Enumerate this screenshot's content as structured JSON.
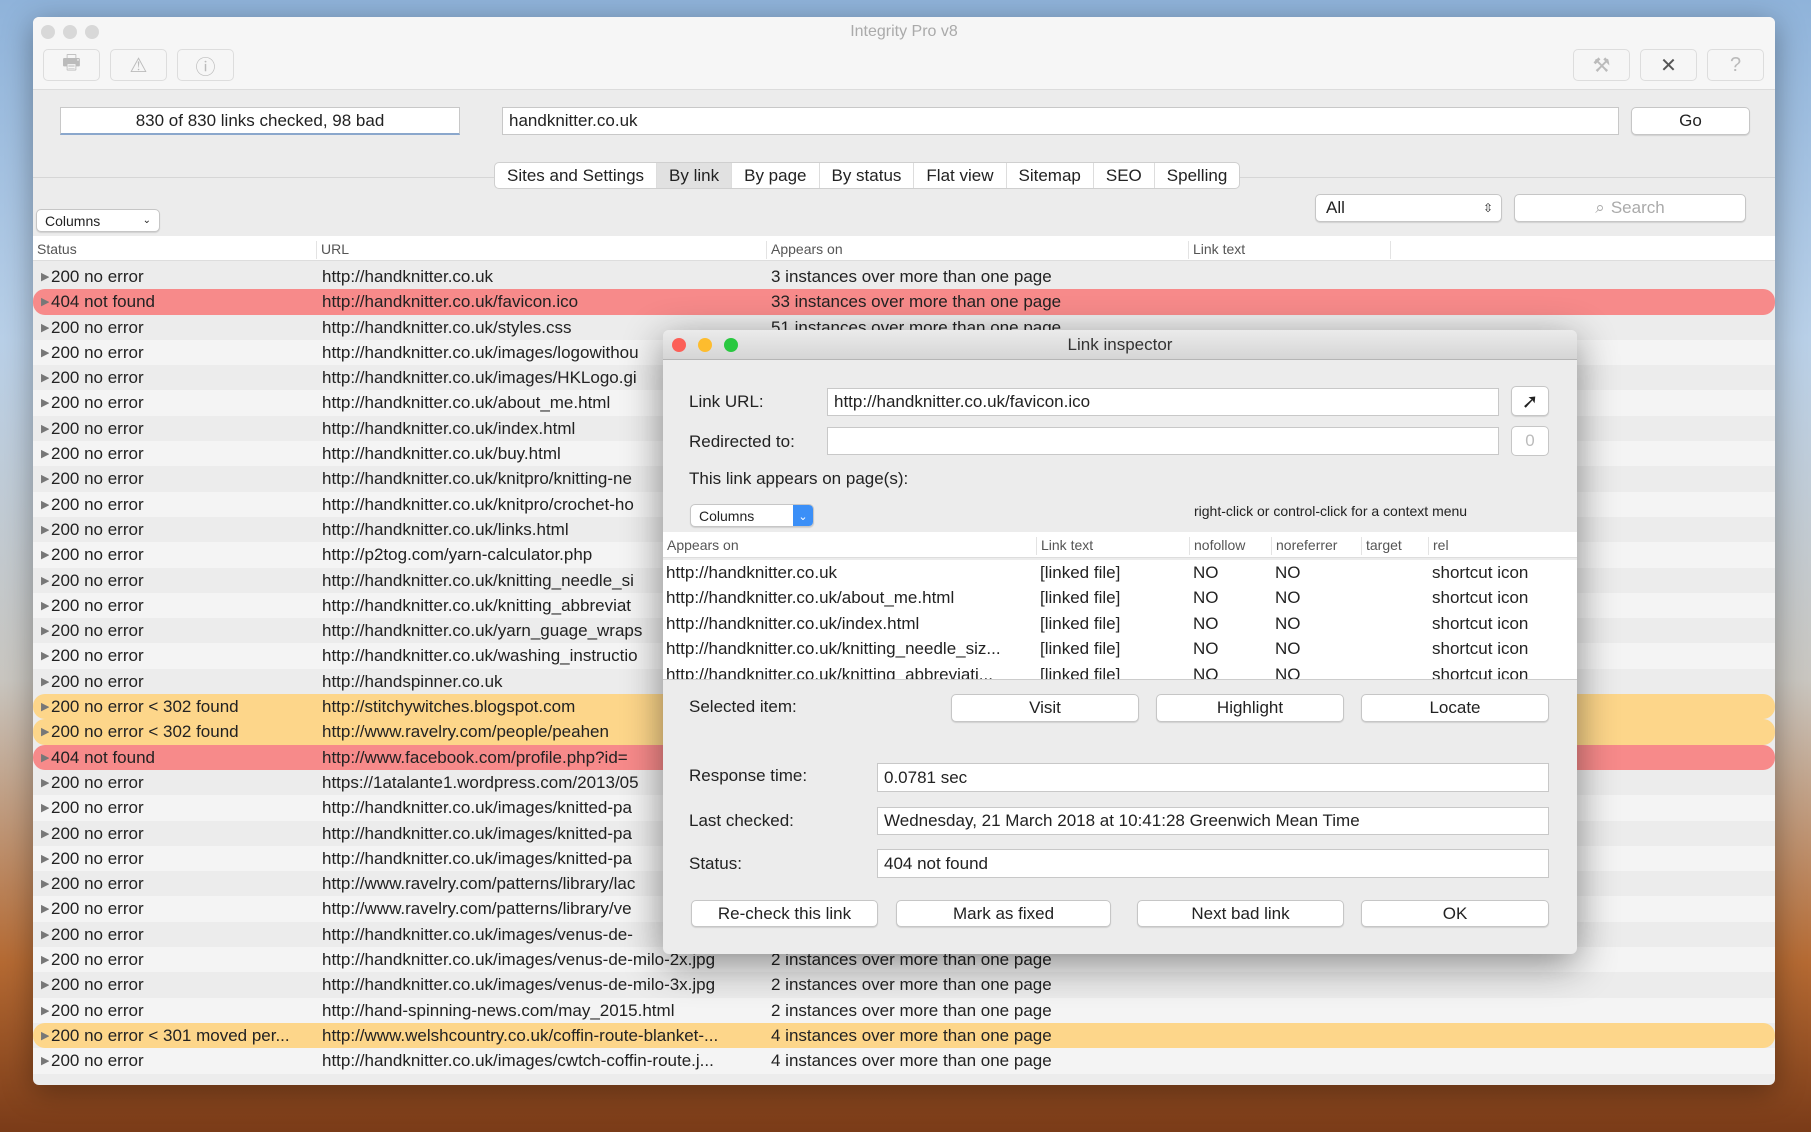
{
  "window": {
    "title": "Integrity Pro v8",
    "toolbar_left": [
      {
        "icon": "printer-icon",
        "glyph": "🖶"
      },
      {
        "icon": "warning-icon",
        "glyph": "⚠"
      },
      {
        "icon": "info-icon",
        "glyph": "ⓘ"
      }
    ],
    "toolbar_right": [
      {
        "icon": "filter-settings-icon",
        "glyph": "⚒"
      },
      {
        "icon": "tools-icon",
        "glyph": "✕"
      },
      {
        "icon": "help-icon",
        "glyph": "?"
      }
    ]
  },
  "progress": "830 of 830 links checked, 98 bad",
  "url_field": "handknitter.co.uk",
  "go_label": "Go",
  "tabs": [
    {
      "label": "Sites and Settings"
    },
    {
      "label": "By link",
      "selected": true
    },
    {
      "label": "By page"
    },
    {
      "label": "By status"
    },
    {
      "label": "Flat view"
    },
    {
      "label": "Sitemap"
    },
    {
      "label": "SEO"
    },
    {
      "label": "Spelling"
    }
  ],
  "columns_label": "Columns",
  "filter_value": "All",
  "search_placeholder": "Search",
  "headers": [
    "Status",
    "URL",
    "Appears on",
    "Link text"
  ],
  "colors": {
    "bad": "#f78a8a",
    "redirect": "#fdd68a"
  },
  "rows": [
    {
      "status": "200 no error",
      "url": "http://handknitter.co.uk",
      "appears": "3 instances over more than one page"
    },
    {
      "status": "404 not found",
      "url": "http://handknitter.co.uk/favicon.ico",
      "appears": "33 instances over more than one page",
      "type": "red"
    },
    {
      "status": "200 no error",
      "url": "http://handknitter.co.uk/styles.css",
      "appears": "51 instances over more than one page"
    },
    {
      "status": "200 no error",
      "url": "http://handknitter.co.uk/images/logowithou",
      "appears": ""
    },
    {
      "status": "200 no error",
      "url": "http://handknitter.co.uk/images/HKLogo.gi",
      "appears": ""
    },
    {
      "status": "200 no error",
      "url": "http://handknitter.co.uk/about_me.html",
      "appears": ""
    },
    {
      "status": "200 no error",
      "url": "http://handknitter.co.uk/index.html",
      "appears": ""
    },
    {
      "status": "200 no error",
      "url": "http://handknitter.co.uk/buy.html",
      "appears": ""
    },
    {
      "status": "200 no error",
      "url": "http://handknitter.co.uk/knitpro/knitting-ne",
      "appears": ""
    },
    {
      "status": "200 no error",
      "url": "http://handknitter.co.uk/knitpro/crochet-ho",
      "appears": ""
    },
    {
      "status": "200 no error",
      "url": "http://handknitter.co.uk/links.html",
      "appears": ""
    },
    {
      "status": "200 no error",
      "url": "http://p2tog.com/yarn-calculator.php",
      "appears": ""
    },
    {
      "status": "200 no error",
      "url": "http://handknitter.co.uk/knitting_needle_si",
      "appears": ""
    },
    {
      "status": "200 no error",
      "url": "http://handknitter.co.uk/knitting_abbreviat",
      "appears": ""
    },
    {
      "status": "200 no error",
      "url": "http://handknitter.co.uk/yarn_guage_wraps",
      "appears": ""
    },
    {
      "status": "200 no error",
      "url": "http://handknitter.co.uk/washing_instructio",
      "appears": ""
    },
    {
      "status": "200 no error",
      "url": "http://handspinner.co.uk",
      "appears": ""
    },
    {
      "status": "200 no error < 302 found",
      "url": "http://stitchywitches.blogspot.com",
      "appears": "",
      "type": "orange"
    },
    {
      "status": "200 no error < 302 found",
      "url": "http://www.ravelry.com/people/peahen",
      "appears": "",
      "type": "orange"
    },
    {
      "status": "404 not found",
      "url": "http://www.facebook.com/profile.php?id=",
      "appears": "",
      "type": "red"
    },
    {
      "status": "200 no error",
      "url": "https://1atalante1.wordpress.com/2013/05",
      "appears": ""
    },
    {
      "status": "200 no error",
      "url": "http://handknitter.co.uk/images/knitted-pa",
      "appears": ""
    },
    {
      "status": "200 no error",
      "url": "http://handknitter.co.uk/images/knitted-pa",
      "appears": ""
    },
    {
      "status": "200 no error",
      "url": "http://handknitter.co.uk/images/knitted-pa",
      "appears": ""
    },
    {
      "status": "200 no error",
      "url": "http://www.ravelry.com/patterns/library/lac",
      "appears": ""
    },
    {
      "status": "200 no error",
      "url": "http://www.ravelry.com/patterns/library/ve",
      "appears": ""
    },
    {
      "status": "200 no error",
      "url": "http://handknitter.co.uk/images/venus-de-",
      "appears": ""
    },
    {
      "status": "200 no error",
      "url": "http://handknitter.co.uk/images/venus-de-milo-2x.jpg",
      "appears": "2 instances over more than one page"
    },
    {
      "status": "200 no error",
      "url": "http://handknitter.co.uk/images/venus-de-milo-3x.jpg",
      "appears": "2 instances over more than one page"
    },
    {
      "status": "200 no error",
      "url": "http://hand-spinning-news.com/may_2015.html",
      "appears": "2 instances over more than one page"
    },
    {
      "status": "200 no error < 301 moved per...",
      "url": "http://www.welshcountry.co.uk/coffin-route-blanket-...",
      "appears": "4 instances over more than one page",
      "type": "orange"
    },
    {
      "status": "200 no error",
      "url": "http://handknitter.co.uk/images/cwtch-coffin-route.j...",
      "appears": "4 instances over more than one page"
    }
  ],
  "inspector": {
    "title": "Link inspector",
    "link_url_label": "Link URL:",
    "link_url": "http://handknitter.co.uk/favicon.ico",
    "redirected_label": "Redirected to:",
    "redirected": "",
    "redirect_count": "0",
    "appears_label": "This link appears on page(s):",
    "columns_label": "Columns",
    "hint": "right-click or control-click for a context menu",
    "headers": [
      "Appears on",
      "Link text",
      "nofollow",
      "noreferrer",
      "target",
      "rel"
    ],
    "rows": [
      [
        "http://handknitter.co.uk",
        "[linked file]",
        "NO",
        "NO",
        "",
        "shortcut icon"
      ],
      [
        "http://handknitter.co.uk/about_me.html",
        "[linked file]",
        "NO",
        "NO",
        "",
        "shortcut icon"
      ],
      [
        "http://handknitter.co.uk/index.html",
        "[linked file]",
        "NO",
        "NO",
        "",
        "shortcut icon"
      ],
      [
        "http://handknitter.co.uk/knitting_needle_siz...",
        "[linked file]",
        "NO",
        "NO",
        "",
        "shortcut icon"
      ],
      [
        "http://handknitter.co.uk/knitting_abbreviati...",
        "[linked file]",
        "NO",
        "NO",
        "",
        "shortcut icon"
      ]
    ],
    "selected_label": "Selected item:",
    "visit": "Visit",
    "highlight": "Highlight",
    "locate": "Locate",
    "response_label": "Response time:",
    "response": "0.0781 sec",
    "checked_label": "Last checked:",
    "checked": "Wednesday, 21 March 2018 at 10:41:28 Greenwich Mean Time",
    "status_label": "Status:",
    "status": "404 not found",
    "recheck": "Re-check this link",
    "mark_fixed": "Mark as fixed",
    "next_bad": "Next bad link",
    "ok": "OK"
  }
}
